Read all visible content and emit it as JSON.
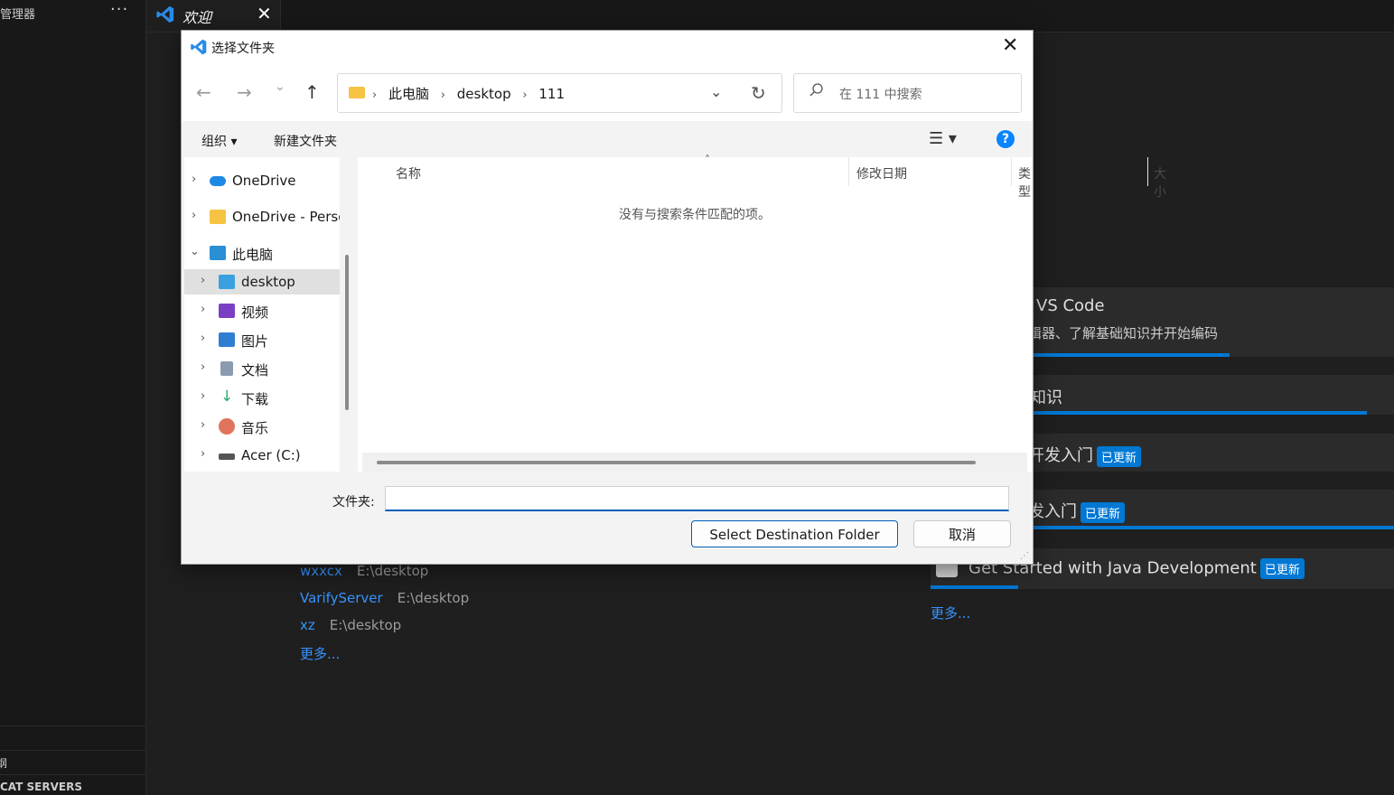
{
  "vscode": {
    "sidebar_title": "管理器",
    "sidebar_more": "···",
    "sidebar_bottom_1": "纲",
    "sidebar_bottom_2": "CAT SERVERS",
    "tab_label": "欢迎",
    "tab_close": "✕",
    "walkthroughs": [
      {
        "title": "VS Code",
        "subtitle": "辑器、了解基础知识并开始编码"
      },
      {
        "title": "知识"
      },
      {
        "title": "开发入门",
        "badge": "已更新"
      },
      {
        "title": "发入门",
        "badge": "已更新"
      },
      {
        "title": "Get Started with Java Development",
        "badge": "已更新"
      }
    ],
    "walkthrough_more": "更多...",
    "recent": [
      {
        "name": "wxxcx",
        "path": "E:\\desktop"
      },
      {
        "name": "VarifyServer",
        "path": "E:\\desktop"
      },
      {
        "name": "xz",
        "path": "E:\\desktop"
      }
    ],
    "recent_more": "更多..."
  },
  "dialog": {
    "title": "选择文件夹",
    "close": "✕",
    "nav": {
      "back": "←",
      "forward": "→",
      "recent": "⌄",
      "up": "↑"
    },
    "breadcrumbs": [
      "此电脑",
      "desktop",
      "111"
    ],
    "breadcrumb_sep": "›",
    "address_dropdown": "⌄",
    "refresh": "↻",
    "search_placeholder": "在 111 中搜索",
    "toolbar": {
      "organize": "组织 ▾",
      "new_folder": "新建文件夹",
      "view": "☰ ▾",
      "help": "?"
    },
    "tree": [
      {
        "label": "OneDrive",
        "chevron": "›",
        "icon": "cloud-icon",
        "color": "#1e88e5"
      },
      {
        "label": "OneDrive - Perso",
        "chevron": "›",
        "icon": "folder-icon",
        "color": "#f6c343"
      },
      {
        "label": "此电脑",
        "chevron": "⌄",
        "icon": "monitor-icon",
        "color": "#2b8fd6"
      },
      {
        "label": "desktop",
        "chevron": "›",
        "icon": "desktop-icon",
        "color": "#3aa0e0"
      },
      {
        "label": "视频",
        "chevron": "›",
        "icon": "video-icon",
        "color": "#7b3fc4"
      },
      {
        "label": "图片",
        "chevron": "›",
        "icon": "picture-icon",
        "color": "#2f7fd1"
      },
      {
        "label": "文档",
        "chevron": "›",
        "icon": "document-icon",
        "color": "#8a9bb0"
      },
      {
        "label": "下载",
        "chevron": "›",
        "icon": "download-icon",
        "color": "#2fa86a"
      },
      {
        "label": "音乐",
        "chevron": "›",
        "icon": "music-icon",
        "color": "#e0735c"
      },
      {
        "label": "Acer (C:)",
        "chevron": "›",
        "icon": "drive-icon",
        "color": "#555555"
      }
    ],
    "columns": [
      "名称",
      "修改日期",
      "类型",
      "大小"
    ],
    "sort_caret": "˄",
    "empty_message": "没有与搜索条件匹配的项。",
    "folder_label": "文件夹:",
    "folder_value": "",
    "select_button": "Select Destination Folder",
    "cancel_button": "取消"
  },
  "colors": {
    "accent": "#0078d4",
    "link": "#3794ff",
    "dialog_bg": "#f3f3f3"
  }
}
